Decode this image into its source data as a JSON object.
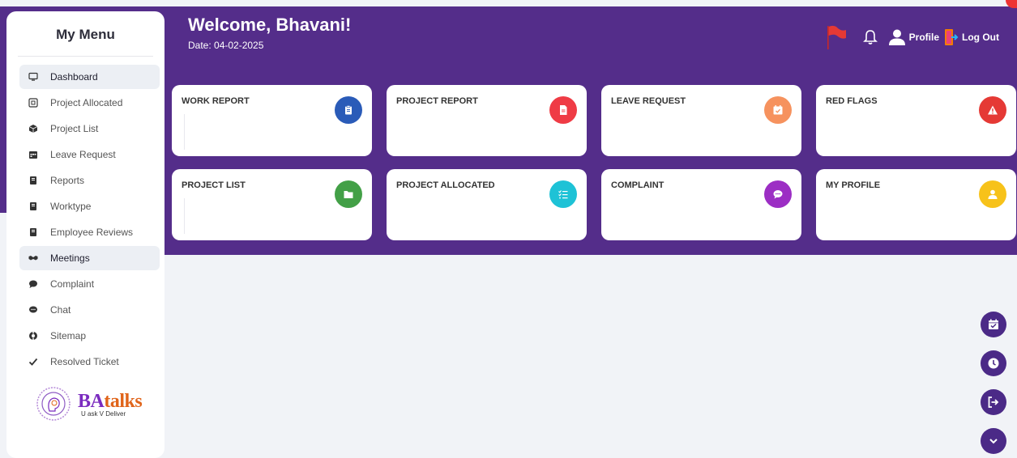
{
  "sidebar": {
    "title": "My Menu",
    "items": [
      {
        "label": "Dashboard",
        "icon": "monitor-icon"
      },
      {
        "label": "Project Allocated",
        "icon": "square-dot-icon"
      },
      {
        "label": "Project List",
        "icon": "cube-icon"
      },
      {
        "label": "Leave Request",
        "icon": "calendar-icon"
      },
      {
        "label": "Reports",
        "icon": "book-icon"
      },
      {
        "label": "Worktype",
        "icon": "book-icon"
      },
      {
        "label": "Employee Reviews",
        "icon": "book-icon"
      },
      {
        "label": "Meetings",
        "icon": "handshake-icon"
      },
      {
        "label": "Complaint",
        "icon": "comment-icon"
      },
      {
        "label": "Chat",
        "icon": "chat-icon"
      },
      {
        "label": "Sitemap",
        "icon": "sitemap-icon"
      },
      {
        "label": "Resolved Ticket",
        "icon": "check-icon"
      }
    ],
    "logo": {
      "brand_a": "BA",
      "brand_b": "talks",
      "tagline": "U ask V Deliver"
    }
  },
  "header": {
    "welcome": "Welcome, Bhavani!",
    "date": "Date: 04-02-2025",
    "profile_label": "Profile",
    "logout_label": "Log Out"
  },
  "cards": [
    {
      "title": "WORK REPORT",
      "icon": "clipboard-icon",
      "color": "#2a5bb8"
    },
    {
      "title": "PROJECT REPORT",
      "icon": "file-icon",
      "color": "#ef3b45"
    },
    {
      "title": "LEAVE REQUEST",
      "icon": "calendar-check-icon",
      "color": "#f6925e"
    },
    {
      "title": "RED FLAGS",
      "icon": "warning-icon",
      "color": "#e53935"
    },
    {
      "title": "PROJECT LIST",
      "icon": "folder-icon",
      "color": "#43a047"
    },
    {
      "title": "PROJECT ALLOCATED",
      "icon": "list-check-icon",
      "color": "#1ec2d6"
    },
    {
      "title": "COMPLAINT",
      "icon": "comment-dots-icon",
      "color": "#9c2ec4"
    },
    {
      "title": "MY PROFILE",
      "icon": "user-icon",
      "color": "#f7c21a"
    }
  ],
  "colors": {
    "header": "#542d8a",
    "fab": "#4b2a87"
  }
}
